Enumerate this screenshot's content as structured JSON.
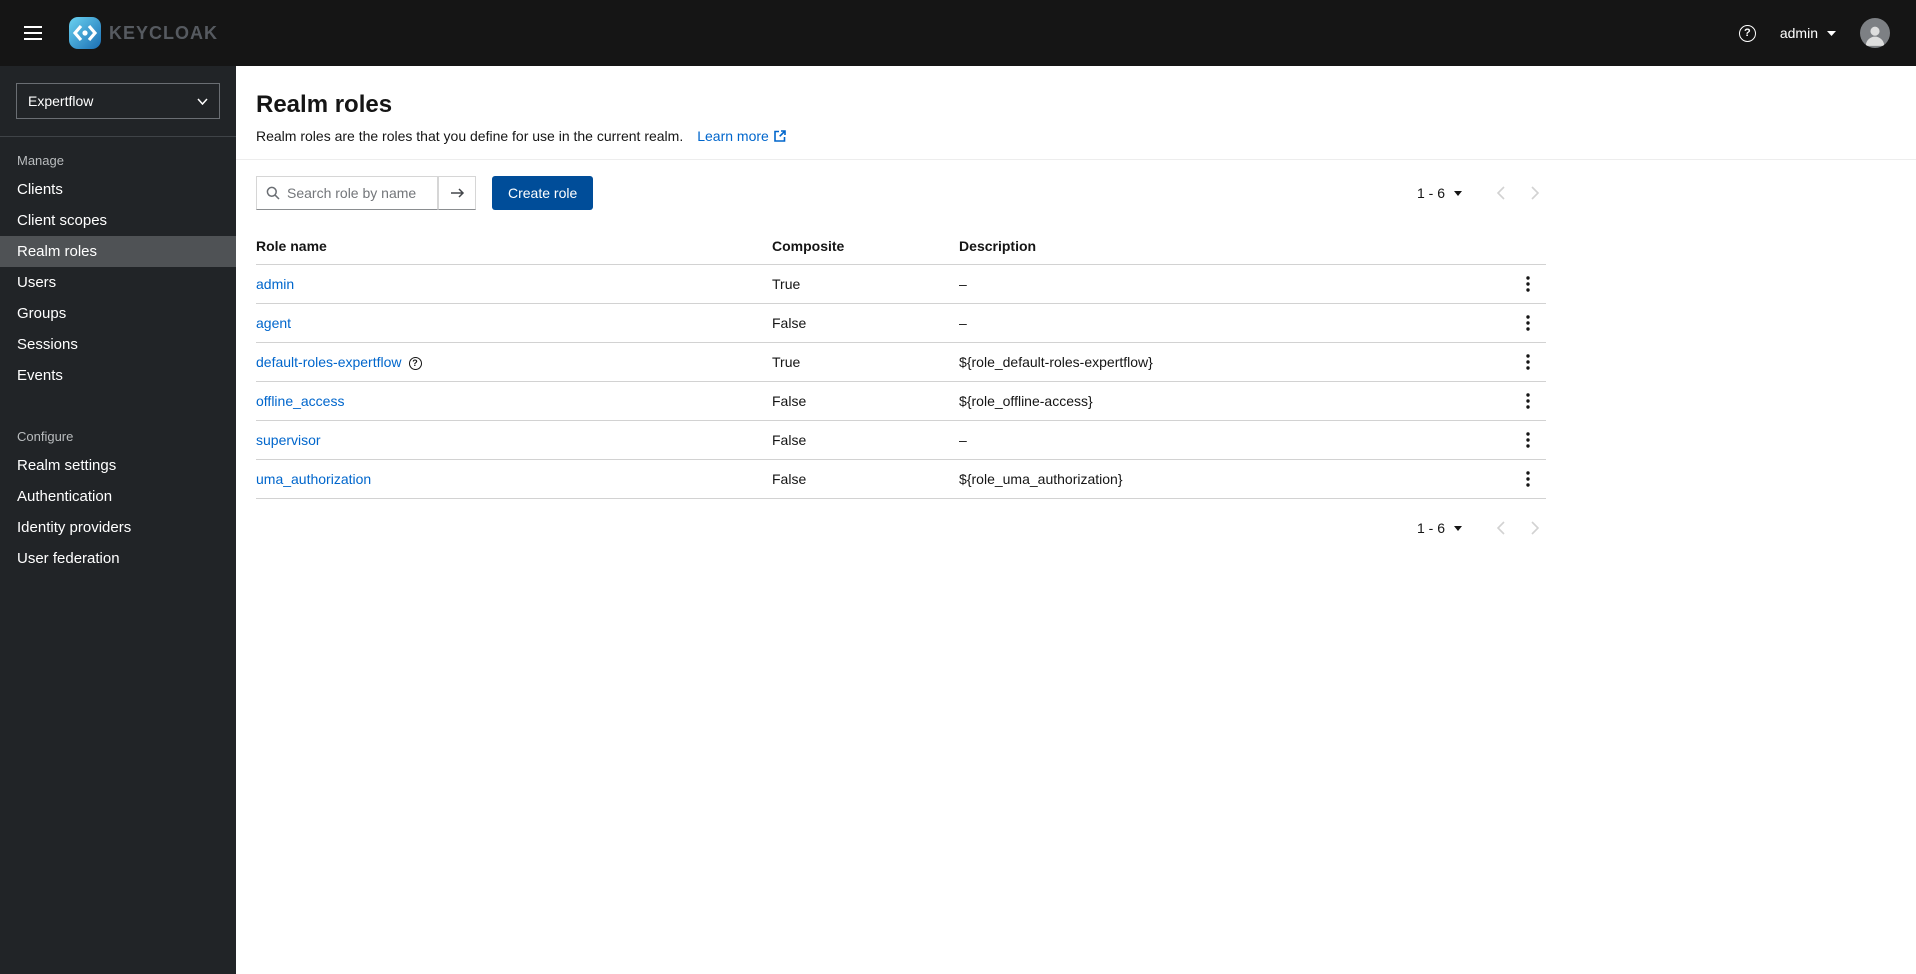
{
  "colors": {
    "accent": "#0066cc",
    "header_bg": "#151515",
    "sidebar_bg": "#212427",
    "sidebar_active_bg": "#4f5255",
    "primary_button": "#004d99",
    "table_border": "#d2d2d2"
  },
  "icons": {
    "question_mark": "?"
  },
  "header": {
    "brand": "KEYCLOAK",
    "user": "admin"
  },
  "sidebar": {
    "realm_selector": {
      "value": "Expertflow"
    },
    "sections": [
      {
        "title": "Manage",
        "items": [
          {
            "label": "Clients",
            "active": false
          },
          {
            "label": "Client scopes",
            "active": false
          },
          {
            "label": "Realm roles",
            "active": true
          },
          {
            "label": "Users",
            "active": false
          },
          {
            "label": "Groups",
            "active": false
          },
          {
            "label": "Sessions",
            "active": false
          },
          {
            "label": "Events",
            "active": false
          }
        ]
      },
      {
        "title": "Configure",
        "items": [
          {
            "label": "Realm settings",
            "active": false
          },
          {
            "label": "Authentication",
            "active": false
          },
          {
            "label": "Identity providers",
            "active": false
          },
          {
            "label": "User federation",
            "active": false
          }
        ]
      }
    ]
  },
  "main": {
    "title": "Realm roles",
    "subtitle": "Realm roles are the roles that you define for use in the current realm.",
    "learn_more_label": "Learn more",
    "toolbar": {
      "search_placeholder": "Search role by name",
      "create_button_label": "Create role"
    },
    "pagination": {
      "range": "1 - 6"
    },
    "table": {
      "headers": [
        "Role name",
        "Composite",
        "Description"
      ],
      "rows": [
        {
          "role_name": "admin",
          "composite": "True",
          "description": "–"
        },
        {
          "role_name": "agent",
          "composite": "False",
          "description": "–"
        },
        {
          "role_name": "default-roles-expertflow",
          "composite": "True",
          "description": "${role_default-roles-expertflow}",
          "has_help_icon": true
        },
        {
          "role_name": "offline_access",
          "composite": "False",
          "description": "${role_offline-access}"
        },
        {
          "role_name": "supervisor",
          "composite": "False",
          "description": "–"
        },
        {
          "role_name": "uma_authorization",
          "composite": "False",
          "description": "${role_uma_authorization}"
        }
      ]
    }
  }
}
